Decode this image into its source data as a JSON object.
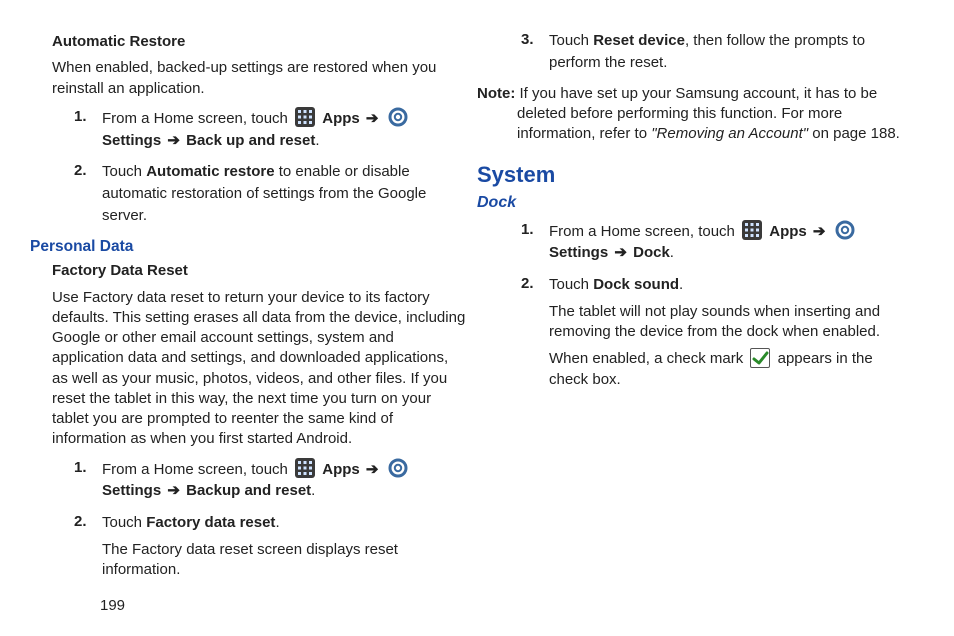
{
  "page_number": "199",
  "icons": {
    "apps": "apps-icon",
    "settings": "settings-icon",
    "check": "check-icon"
  },
  "left": {
    "auto_restore_h": "Automatic Restore",
    "auto_restore_p": "When enabled, backed-up settings are restored when you reinstall an application.",
    "ar1_num": "1.",
    "ar1_a": "From a Home screen, touch ",
    "ar1_apps": "Apps",
    "ar1_arrow1": "➔",
    "ar1_settings": "Settings",
    "ar1_arrow2": "➔",
    "ar1_b": "Back up and reset",
    "ar1_dot": ".",
    "ar2_num": "2.",
    "ar2_a": "Touch ",
    "ar2_b": "Automatic restore",
    "ar2_c": " to enable or disable automatic restoration of settings from the Google server.",
    "pd_h": "Personal Data",
    "fdr_h": "Factory Data Reset",
    "fdr_p": "Use Factory data reset to return your device to its factory defaults. This setting erases all data from the device, including Google or other email account settings, system and application data and settings, and downloaded applications, as well as your music, photos, videos, and other files. If you reset the tablet in this way, the next time you turn on your tablet you are prompted to reenter the same kind of information as when you first started Android.",
    "fd1_num": "1.",
    "fd1_a": "From a Home screen, touch ",
    "fd1_apps": "Apps",
    "fd1_arrow1": "➔",
    "fd1_settings": "Settings",
    "fd1_arrow2": "➔",
    "fd1_b": "Backup and reset",
    "fd1_dot": ".",
    "fd2_num": "2.",
    "fd2_a": "Touch ",
    "fd2_b": "Factory data reset",
    "fd2_dot": ".",
    "fd2_after": "The Factory data reset screen displays reset information."
  },
  "right": {
    "rd3_num": "3.",
    "rd3_a": "Touch ",
    "rd3_b": "Reset device",
    "rd3_c": ", then follow the prompts to perform the reset.",
    "note_label": "Note:",
    "note_a": " If you have set up your Samsung account, it has to be ",
    "note_b": "deleted before performing this function. For more information, refer to ",
    "note_i": "\"Removing an Account\"",
    "note_c": " on page 188.",
    "system_h": "System",
    "dock_h": "Dock",
    "dk1_num": "1.",
    "dk1_a": "From a Home screen, touch ",
    "dk1_apps": "Apps",
    "dk1_arrow1": "➔",
    "dk1_settings": "Settings",
    "dk1_arrow2": "➔",
    "dk1_b": "Dock",
    "dk1_dot": ".",
    "dk2_num": "2.",
    "dk2_a": "Touch ",
    "dk2_b": "Dock sound",
    "dk2_dot": ".",
    "dk2_after1": "The tablet will not play sounds when inserting and removing the device from the dock when enabled.",
    "dk2_after2_a": "When enabled, a check mark ",
    "dk2_after2_b": " appears in the check box."
  }
}
